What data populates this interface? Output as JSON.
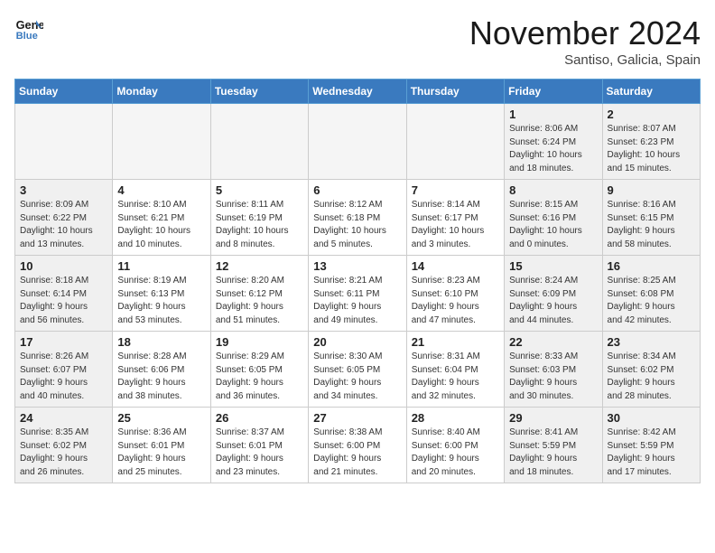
{
  "header": {
    "logo_line1": "General",
    "logo_line2": "Blue",
    "month": "November 2024",
    "location": "Santiso, Galicia, Spain"
  },
  "days_of_week": [
    "Sunday",
    "Monday",
    "Tuesday",
    "Wednesday",
    "Thursday",
    "Friday",
    "Saturday"
  ],
  "weeks": [
    [
      {
        "day": "",
        "info": "",
        "empty": true
      },
      {
        "day": "",
        "info": "",
        "empty": true
      },
      {
        "day": "",
        "info": "",
        "empty": true
      },
      {
        "day": "",
        "info": "",
        "empty": true
      },
      {
        "day": "",
        "info": "",
        "empty": true
      },
      {
        "day": "1",
        "info": "Sunrise: 8:06 AM\nSunset: 6:24 PM\nDaylight: 10 hours\nand 18 minutes.",
        "empty": false,
        "weekend": true
      },
      {
        "day": "2",
        "info": "Sunrise: 8:07 AM\nSunset: 6:23 PM\nDaylight: 10 hours\nand 15 minutes.",
        "empty": false,
        "weekend": true
      }
    ],
    [
      {
        "day": "3",
        "info": "Sunrise: 8:09 AM\nSunset: 6:22 PM\nDaylight: 10 hours\nand 13 minutes.",
        "empty": false,
        "weekend": true
      },
      {
        "day": "4",
        "info": "Sunrise: 8:10 AM\nSunset: 6:21 PM\nDaylight: 10 hours\nand 10 minutes.",
        "empty": false,
        "weekend": false
      },
      {
        "day": "5",
        "info": "Sunrise: 8:11 AM\nSunset: 6:19 PM\nDaylight: 10 hours\nand 8 minutes.",
        "empty": false,
        "weekend": false
      },
      {
        "day": "6",
        "info": "Sunrise: 8:12 AM\nSunset: 6:18 PM\nDaylight: 10 hours\nand 5 minutes.",
        "empty": false,
        "weekend": false
      },
      {
        "day": "7",
        "info": "Sunrise: 8:14 AM\nSunset: 6:17 PM\nDaylight: 10 hours\nand 3 minutes.",
        "empty": false,
        "weekend": false
      },
      {
        "day": "8",
        "info": "Sunrise: 8:15 AM\nSunset: 6:16 PM\nDaylight: 10 hours\nand 0 minutes.",
        "empty": false,
        "weekend": true
      },
      {
        "day": "9",
        "info": "Sunrise: 8:16 AM\nSunset: 6:15 PM\nDaylight: 9 hours\nand 58 minutes.",
        "empty": false,
        "weekend": true
      }
    ],
    [
      {
        "day": "10",
        "info": "Sunrise: 8:18 AM\nSunset: 6:14 PM\nDaylight: 9 hours\nand 56 minutes.",
        "empty": false,
        "weekend": true
      },
      {
        "day": "11",
        "info": "Sunrise: 8:19 AM\nSunset: 6:13 PM\nDaylight: 9 hours\nand 53 minutes.",
        "empty": false,
        "weekend": false
      },
      {
        "day": "12",
        "info": "Sunrise: 8:20 AM\nSunset: 6:12 PM\nDaylight: 9 hours\nand 51 minutes.",
        "empty": false,
        "weekend": false
      },
      {
        "day": "13",
        "info": "Sunrise: 8:21 AM\nSunset: 6:11 PM\nDaylight: 9 hours\nand 49 minutes.",
        "empty": false,
        "weekend": false
      },
      {
        "day": "14",
        "info": "Sunrise: 8:23 AM\nSunset: 6:10 PM\nDaylight: 9 hours\nand 47 minutes.",
        "empty": false,
        "weekend": false
      },
      {
        "day": "15",
        "info": "Sunrise: 8:24 AM\nSunset: 6:09 PM\nDaylight: 9 hours\nand 44 minutes.",
        "empty": false,
        "weekend": true
      },
      {
        "day": "16",
        "info": "Sunrise: 8:25 AM\nSunset: 6:08 PM\nDaylight: 9 hours\nand 42 minutes.",
        "empty": false,
        "weekend": true
      }
    ],
    [
      {
        "day": "17",
        "info": "Sunrise: 8:26 AM\nSunset: 6:07 PM\nDaylight: 9 hours\nand 40 minutes.",
        "empty": false,
        "weekend": true
      },
      {
        "day": "18",
        "info": "Sunrise: 8:28 AM\nSunset: 6:06 PM\nDaylight: 9 hours\nand 38 minutes.",
        "empty": false,
        "weekend": false
      },
      {
        "day": "19",
        "info": "Sunrise: 8:29 AM\nSunset: 6:05 PM\nDaylight: 9 hours\nand 36 minutes.",
        "empty": false,
        "weekend": false
      },
      {
        "day": "20",
        "info": "Sunrise: 8:30 AM\nSunset: 6:05 PM\nDaylight: 9 hours\nand 34 minutes.",
        "empty": false,
        "weekend": false
      },
      {
        "day": "21",
        "info": "Sunrise: 8:31 AM\nSunset: 6:04 PM\nDaylight: 9 hours\nand 32 minutes.",
        "empty": false,
        "weekend": false
      },
      {
        "day": "22",
        "info": "Sunrise: 8:33 AM\nSunset: 6:03 PM\nDaylight: 9 hours\nand 30 minutes.",
        "empty": false,
        "weekend": true
      },
      {
        "day": "23",
        "info": "Sunrise: 8:34 AM\nSunset: 6:02 PM\nDaylight: 9 hours\nand 28 minutes.",
        "empty": false,
        "weekend": true
      }
    ],
    [
      {
        "day": "24",
        "info": "Sunrise: 8:35 AM\nSunset: 6:02 PM\nDaylight: 9 hours\nand 26 minutes.",
        "empty": false,
        "weekend": true
      },
      {
        "day": "25",
        "info": "Sunrise: 8:36 AM\nSunset: 6:01 PM\nDaylight: 9 hours\nand 25 minutes.",
        "empty": false,
        "weekend": false
      },
      {
        "day": "26",
        "info": "Sunrise: 8:37 AM\nSunset: 6:01 PM\nDaylight: 9 hours\nand 23 minutes.",
        "empty": false,
        "weekend": false
      },
      {
        "day": "27",
        "info": "Sunrise: 8:38 AM\nSunset: 6:00 PM\nDaylight: 9 hours\nand 21 minutes.",
        "empty": false,
        "weekend": false
      },
      {
        "day": "28",
        "info": "Sunrise: 8:40 AM\nSunset: 6:00 PM\nDaylight: 9 hours\nand 20 minutes.",
        "empty": false,
        "weekend": false
      },
      {
        "day": "29",
        "info": "Sunrise: 8:41 AM\nSunset: 5:59 PM\nDaylight: 9 hours\nand 18 minutes.",
        "empty": false,
        "weekend": true
      },
      {
        "day": "30",
        "info": "Sunrise: 8:42 AM\nSunset: 5:59 PM\nDaylight: 9 hours\nand 17 minutes.",
        "empty": false,
        "weekend": true
      }
    ]
  ]
}
